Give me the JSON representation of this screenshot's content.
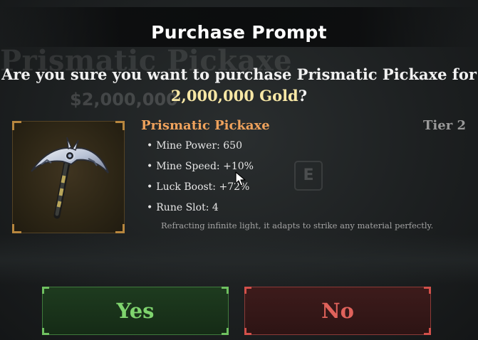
{
  "background": {
    "ghost_title": "Prismatic Pickaxe",
    "ghost_price": "$2,000,000",
    "key_hint": "E"
  },
  "header": {
    "title": "Purchase Prompt"
  },
  "prompt": {
    "line1": "Are you sure you want to purchase Prismatic Pickaxe for",
    "price": "2,000,000 Gold",
    "end_punct": "?"
  },
  "item": {
    "icon": "pickaxe-icon",
    "name": "Prismatic Pickaxe",
    "tier": "Tier 2",
    "stats": [
      {
        "label": "Mine Power:",
        "value": "650"
      },
      {
        "label": "Mine Speed:",
        "value": "+10%"
      },
      {
        "label": "Luck Boost:",
        "value": "+72%"
      },
      {
        "label": "Rune Slot:",
        "value": "4"
      }
    ],
    "description": "Refracting infinite light, it adapts to strike any material perfectly."
  },
  "buttons": {
    "yes_label": "Yes",
    "no_label": "No"
  },
  "colors": {
    "item_name": "#efa25c",
    "price_gold": "#f7e7a5",
    "yes_text": "#7fd46e",
    "no_text": "#e0625b"
  }
}
